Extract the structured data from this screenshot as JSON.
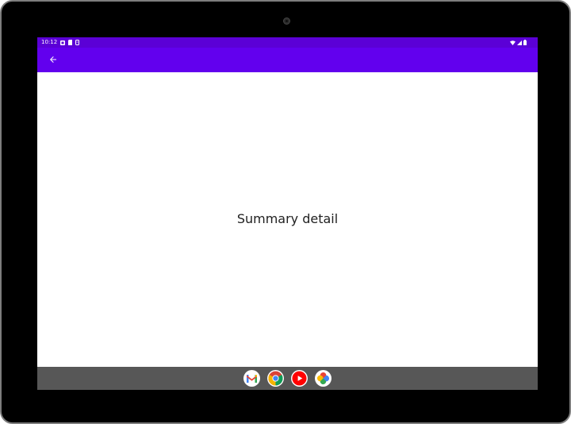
{
  "status_bar": {
    "time": "10:12",
    "left_icons": [
      "notification-icon",
      "sim-card-icon",
      "storage-icon"
    ],
    "right_icons": [
      "wifi-icon",
      "cellular-signal-icon",
      "battery-icon"
    ]
  },
  "app_bar": {
    "back_icon": "arrow-back-icon",
    "color": "#6200ee",
    "status_color": "#5b00d6"
  },
  "content": {
    "text": "Summary detail"
  },
  "dock": {
    "apps": [
      {
        "name": "Gmail",
        "icon": "gmail-icon"
      },
      {
        "name": "Chrome",
        "icon": "chrome-icon"
      },
      {
        "name": "YouTube",
        "icon": "youtube-icon"
      },
      {
        "name": "Photos",
        "icon": "photos-icon"
      }
    ]
  }
}
